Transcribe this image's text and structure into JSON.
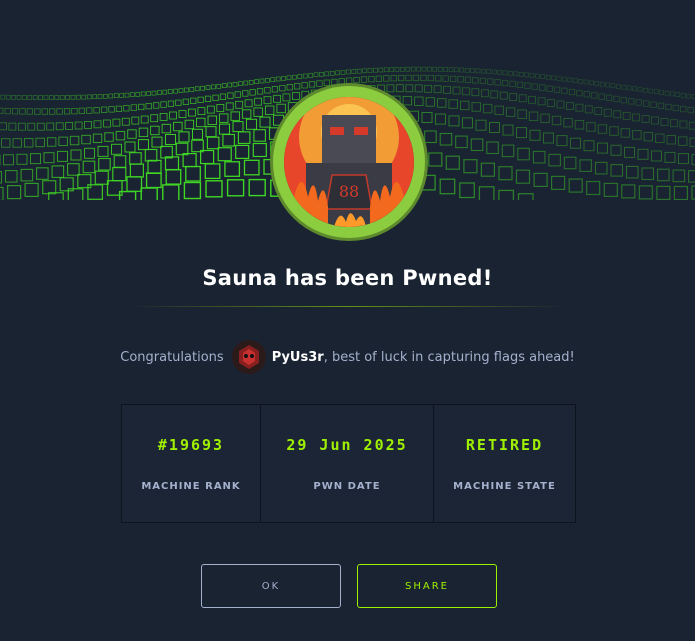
{
  "modal": {
    "title": "Sauna has been Pwned!",
    "congrats_prefix": "Congratulations",
    "username": "PyUs3r",
    "congrats_suffix": ", best of luck in capturing flags ahead!"
  },
  "stats": [
    {
      "value": "#19693",
      "label": "MACHINE RANK"
    },
    {
      "value": "29 Jun 2025",
      "label": "PWN DATE"
    },
    {
      "value": "RETIRED",
      "label": "MACHINE STATE"
    }
  ],
  "buttons": {
    "ok_label": "OK",
    "share_label": "SHARE"
  },
  "colors": {
    "background": "#1a2332",
    "accent": "#9fef00",
    "text_muted": "#a4b1cd",
    "avatar_ring": "#8ccc3f"
  },
  "icons": {
    "banner": "green-cube-wave-banner",
    "machine_avatar": "sauna-machine-avatar",
    "user_avatar": "user-avatar"
  }
}
